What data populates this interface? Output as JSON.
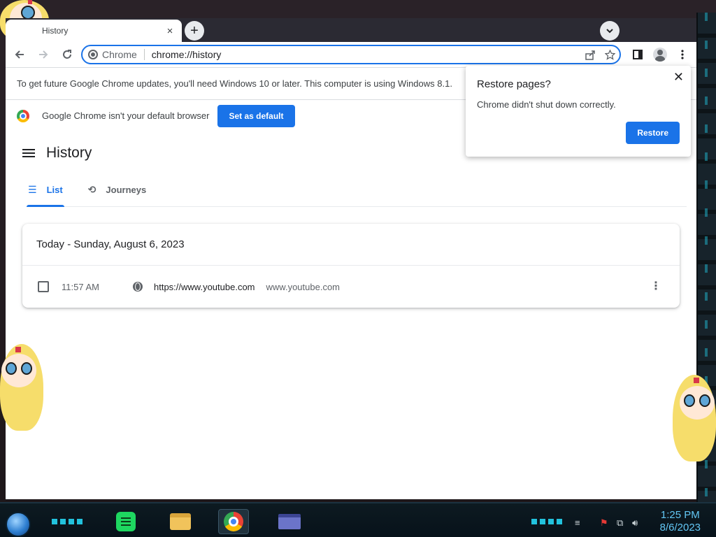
{
  "browser": {
    "tab_title": "History",
    "tab_close": "×",
    "new_tab": "+",
    "omnibox": {
      "chip_label": "Chrome",
      "url": "chrome://history"
    }
  },
  "infobars": {
    "update_message": "To get future Google Chrome updates, you'll need Windows 10 or later. This computer is using Windows 8.1.",
    "default_message": "Google Chrome isn't your default browser",
    "set_default_label": "Set as default"
  },
  "history": {
    "title": "History",
    "tabs": [
      {
        "label": "List",
        "icon": "list-icon"
      },
      {
        "label": "Journeys",
        "icon": "journeys-icon"
      }
    ],
    "section_title": "Today - Sunday, August 6, 2023",
    "entries": [
      {
        "time": "11:57 AM",
        "title": "https://www.youtube.com",
        "domain": "www.youtube.com"
      }
    ]
  },
  "popup": {
    "title": "Restore pages?",
    "message": "Chrome didn't shut down correctly.",
    "restore_label": "Restore",
    "close": "✕"
  },
  "taskbar": {
    "time": "1:25 PM",
    "date": "8/6/2023"
  },
  "colors": {
    "accent": "#1a73e8",
    "tabstrip": "#2b2a33",
    "clock": "#63c7f5"
  }
}
